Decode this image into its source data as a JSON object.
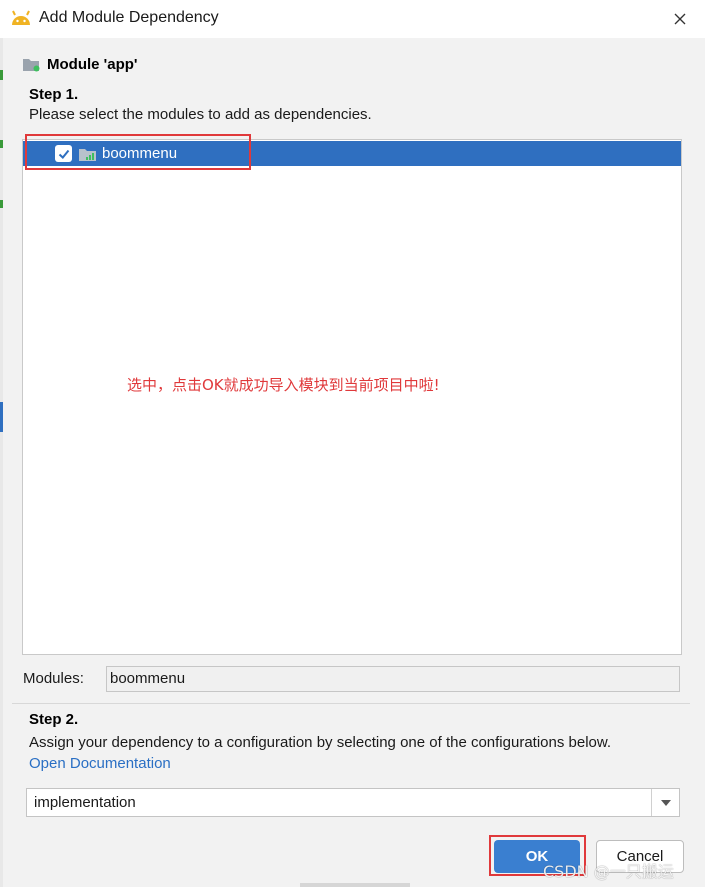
{
  "window": {
    "title": "Add Module Dependency",
    "icon": "android-icon",
    "close_glyph": "✕"
  },
  "module": {
    "heading": "Module 'app'",
    "icon": "module-folder-icon"
  },
  "step1": {
    "title": "Step 1.",
    "description": "Please select the modules to add as dependencies."
  },
  "module_list": {
    "items": [
      {
        "label": "boommenu",
        "checked": true,
        "selected": true,
        "icon": "library-module-icon"
      }
    ]
  },
  "annotation": {
    "text": "选中，点击OK就成功导入模块到当前项目中啦!",
    "color": "#e0393b"
  },
  "modules_field": {
    "label": "Modules:",
    "value": "boommenu"
  },
  "step2": {
    "title": "Step 2.",
    "description": "Assign your dependency to a configuration by selecting one of the configurations below.",
    "link_text": "Open Documentation"
  },
  "configuration": {
    "selected": "implementation"
  },
  "buttons": {
    "ok_label": "OK",
    "cancel_label": "Cancel"
  },
  "watermark": "CSDN @一只搬运",
  "colors": {
    "accent": "#3a7fd0",
    "selection": "#2f6fc0",
    "link": "#2a6fc4",
    "annotation": "#e0393b"
  }
}
